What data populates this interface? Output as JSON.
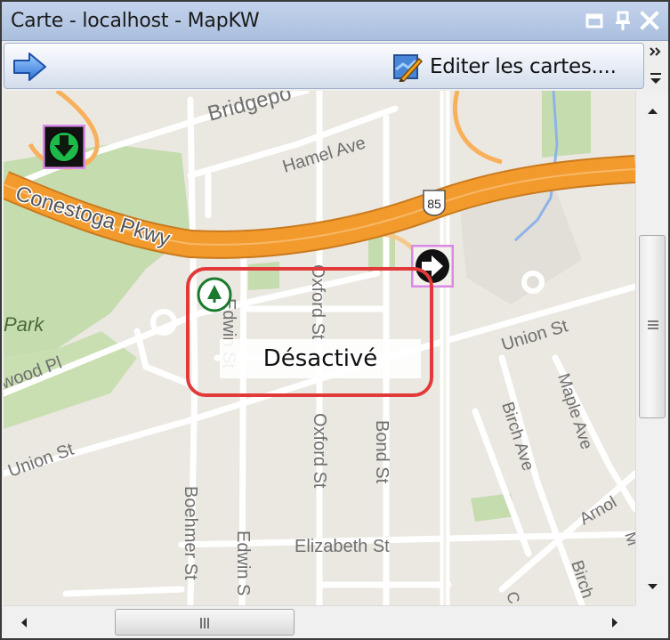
{
  "window": {
    "title": "Carte - localhost - MapKW",
    "controls": [
      "restore-icon",
      "pin-icon",
      "close-icon"
    ]
  },
  "toolbar": {
    "nav_icon": "arrow-right-icon",
    "edit_label": "Editer les cartes....",
    "edit_icon": "map-edit-icon",
    "overflow_icon": "chevron-double-right-icon"
  },
  "map": {
    "streets": {
      "bridgeport": "Bridgepo",
      "hamel": "Hamel Ave",
      "conestoga": "Conestoga Pkwy",
      "highway_shield": "85",
      "park": "Park",
      "edwin_top": "Edwin St",
      "oxford_top": "Oxford St",
      "wood": "wood Pl",
      "union_right": "Union St",
      "union_left": "Union St",
      "maple": "Maple Ave",
      "birch_top": "Birch Ave",
      "oxford_bottom": "Oxford St",
      "bond": "Bond St",
      "boehmer": "Boehmer St",
      "edwin_bottom": "Edwin S",
      "elizabeth": "Elizabeth St",
      "arnold": "Arnol",
      "birch_bottom": "Birch",
      "m_fragment": "M",
      "c_fragment": "C"
    },
    "markers": [
      {
        "name": "down-arrow-marker-icon",
        "status_color": "#1db94a"
      },
      {
        "name": "right-arrow-marker-icon",
        "status_color": "#ffffff"
      },
      {
        "name": "tree-marker-icon",
        "status_color": "#1a7a2e"
      }
    ],
    "tooltip": "Désactivé",
    "highlight_color": "#e23a3a"
  },
  "colors": {
    "titlebar": "#b4c7e4",
    "highway": "#f39a2c",
    "park_green": "#c5dcae",
    "map_bg": "#ebe8e2"
  },
  "scrollbars": {
    "vertical_thumb_grip": "≡",
    "horizontal_thumb_grip": "III"
  }
}
